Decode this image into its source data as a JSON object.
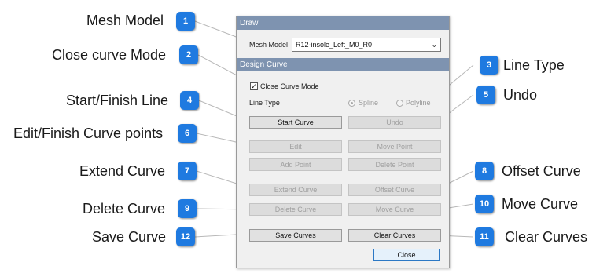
{
  "callouts": [
    {
      "num": "1",
      "label": "Mesh Model"
    },
    {
      "num": "2",
      "label": "Close curve Mode"
    },
    {
      "num": "3",
      "label": "Line Type"
    },
    {
      "num": "4",
      "label": "Start/Finish Line"
    },
    {
      "num": "5",
      "label": "Undo"
    },
    {
      "num": "6",
      "label": "Edit/Finish Curve points"
    },
    {
      "num": "7",
      "label": "Extend Curve"
    },
    {
      "num": "8",
      "label": "Offset Curve"
    },
    {
      "num": "9",
      "label": "Delete Curve"
    },
    {
      "num": "10",
      "label": "Move Curve"
    },
    {
      "num": "11",
      "label": "Clear Curves"
    },
    {
      "num": "12",
      "label": "Save Curve"
    }
  ],
  "colors": {
    "badge": "#1f7ae0",
    "header": "#7e93b0"
  },
  "dialog": {
    "draw_header": "Draw",
    "mesh_model_label": "Mesh Model",
    "mesh_model_value": "R12-insole_Left_M0_R0",
    "design_header": "Design Curve",
    "close_curve_mode": {
      "label": "Close Curve Mode",
      "checked": true
    },
    "line_type_label": "Line Type",
    "line_type_options": [
      "Spline",
      "Polyline"
    ],
    "line_type_selected": "Spline",
    "buttons": {
      "start_curve": "Start Curve",
      "undo": "Undo",
      "edit": "Edit",
      "move_point": "Move Point",
      "add_point": "Add Point",
      "delete_point": "Delete Point",
      "extend_curve": "Extend Curve",
      "offset_curve": "Offset Curve",
      "delete_curve": "Delete Curve",
      "move_curve": "Move Curve",
      "save_curves": "Save Curves",
      "clear_curves": "Clear Curves",
      "close": "Close"
    }
  }
}
